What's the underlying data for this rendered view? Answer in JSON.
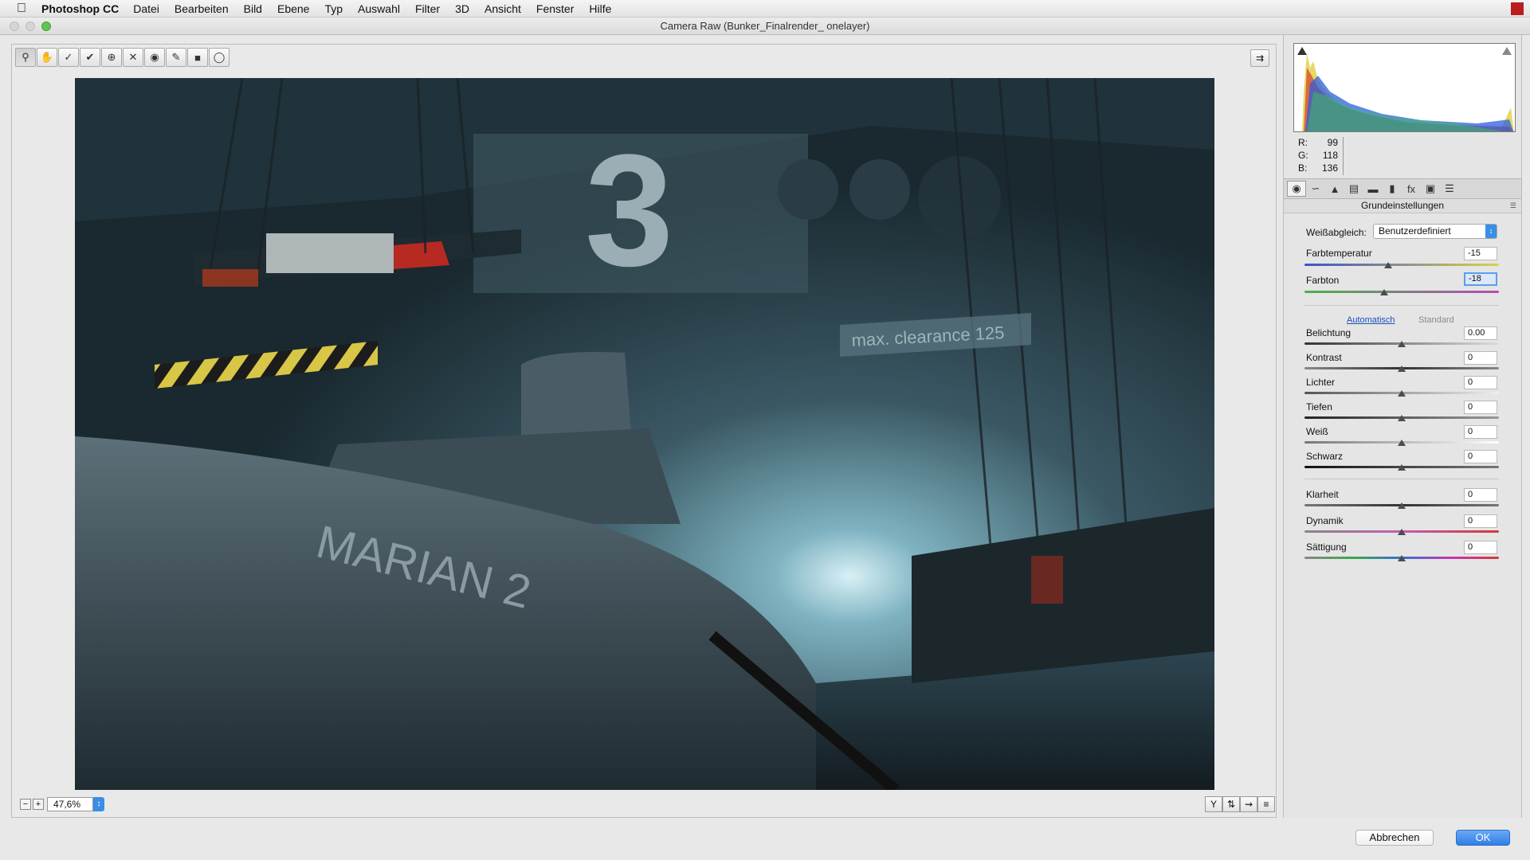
{
  "menubar": {
    "app_name": "Photoshop CC",
    "items": [
      "Datei",
      "Bearbeiten",
      "Bild",
      "Ebene",
      "Typ",
      "Auswahl",
      "Filter",
      "3D",
      "Ansicht",
      "Fenster",
      "Hilfe"
    ]
  },
  "window": {
    "title": "Camera Raw (Bunker_Finalrender_ onelayer)"
  },
  "toolbar": {
    "tools": [
      "zoom-tool",
      "hand-tool",
      "white-balance-tool",
      "color-sampler-tool",
      "targeted-adjustment-tool",
      "spot-removal-tool",
      "red-eye-tool",
      "adjustment-brush-tool",
      "graduated-filter-tool",
      "radial-filter-tool"
    ]
  },
  "preview": {
    "scene_text_large": "3",
    "scene_text_ship": "MARIAN 2",
    "scene_text_sign": "max. clearance 125"
  },
  "zoom": {
    "value": "47,6%"
  },
  "histogram": {
    "readout": {
      "r_label": "R:",
      "r": "99",
      "g_label": "G:",
      "g": "118",
      "b_label": "B:",
      "b": "136"
    }
  },
  "panel": {
    "title": "Grundeinstellungen",
    "tabs": [
      "basic",
      "tone-curve",
      "detail",
      "hsl",
      "split-toning",
      "lens-corrections",
      "effects",
      "camera-calibration",
      "presets"
    ],
    "white_balance": {
      "label": "Weißabgleich:",
      "value": "Benutzerdefiniert"
    },
    "temperature": {
      "label": "Farbtemperatur",
      "value": "-15",
      "position": 0.43
    },
    "tint": {
      "label": "Farbton",
      "value": "-18",
      "position": 0.41
    },
    "auto_label": "Automatisch",
    "default_label": "Standard",
    "tone": [
      {
        "label": "Belichtung",
        "value": "0.00",
        "position": 0.5
      },
      {
        "label": "Kontrast",
        "value": "0",
        "position": 0.5
      },
      {
        "label": "Lichter",
        "value": "0",
        "position": 0.5
      },
      {
        "label": "Tiefen",
        "value": "0",
        "position": 0.5
      },
      {
        "label": "Weiß",
        "value": "0",
        "position": 0.5
      },
      {
        "label": "Schwarz",
        "value": "0",
        "position": 0.5
      }
    ],
    "presence": [
      {
        "label": "Klarheit",
        "value": "0",
        "position": 0.5
      },
      {
        "label": "Dynamik",
        "value": "0",
        "position": 0.5
      },
      {
        "label": "Sättigung",
        "value": "0",
        "position": 0.5
      }
    ]
  },
  "buttons": {
    "cancel": "Abbrechen",
    "ok": "OK"
  },
  "colors": {
    "accent": "#3a8ee6",
    "ok_button": "#2f7fe5",
    "preview_base": "#2c3e48"
  }
}
